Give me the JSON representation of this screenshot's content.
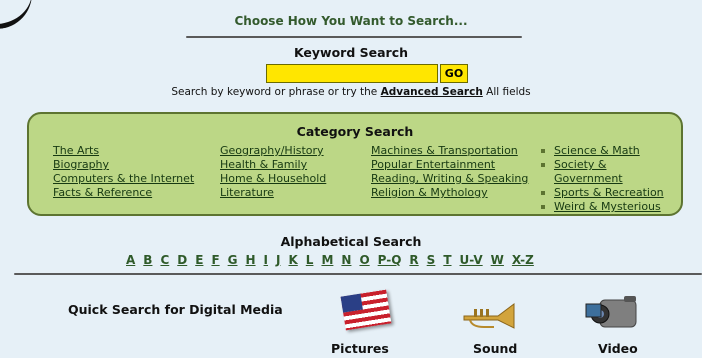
{
  "header": {
    "title": "Choose How You Want to Search..."
  },
  "keyword": {
    "title": "Keyword Search",
    "input_value": "",
    "go_label": "GO",
    "hint_before": "Search by keyword or phrase or try the",
    "advanced_link": "Advanced Search",
    "hint_after": "All fields"
  },
  "category": {
    "title": "Category Search",
    "col1": [
      "The Arts",
      "Biography",
      "Computers & the Internet",
      "Facts & Reference"
    ],
    "col2": [
      "Geography/History",
      "Health & Family",
      "Home & Household",
      "Literature"
    ],
    "col3": [
      "Machines & Transportation",
      "Popular Entertainment",
      "Reading, Writing & Speaking",
      "Religion & Mythology"
    ],
    "col4": [
      "Science & Math",
      "Society &",
      "Government",
      "Sports & Recreation",
      "Weird & Mysterious"
    ]
  },
  "alpha": {
    "title": "Alphabetical Search",
    "letters": [
      "A",
      "B",
      "C",
      "D",
      "E",
      "F",
      "G",
      "H",
      "I",
      "J",
      "K",
      "L",
      "M",
      "N",
      "O",
      "P-Q",
      "R",
      "S",
      "T",
      "U-V",
      "W",
      "X-Z"
    ]
  },
  "media": {
    "title": "Quick Search for Digital Media",
    "pictures": "Pictures",
    "sound": "Sound",
    "video": "Video",
    "icons": [
      "flag-icon",
      "trumpet-icon",
      "video-camera-icon"
    ]
  },
  "colors": {
    "background": "#e6f0f7",
    "accent_green": "#335a2d",
    "category_box": "#bcd786",
    "input_yellow": "#ffe600"
  }
}
